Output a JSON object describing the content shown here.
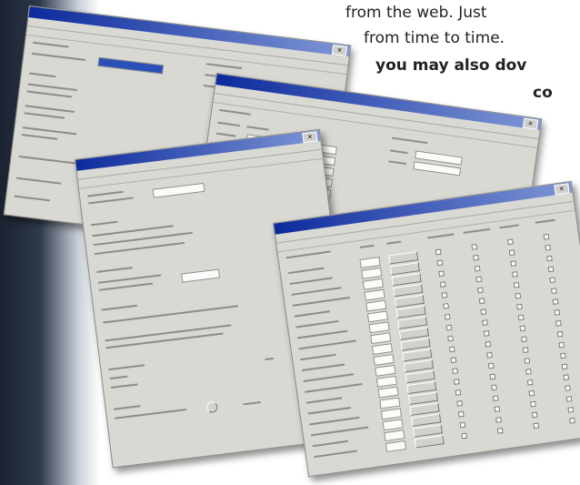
{
  "prose_lines": [
    "from the web. Just",
    "from time to time.",
    "you may also dov",
    "co"
  ],
  "windows": [
    {
      "id": "window-config-1",
      "close_glyph": "×"
    },
    {
      "id": "window-config-2",
      "close_glyph": "×"
    },
    {
      "id": "window-config-3",
      "close_glyph": "×"
    },
    {
      "id": "window-config-4",
      "close_glyph": "×"
    }
  ]
}
